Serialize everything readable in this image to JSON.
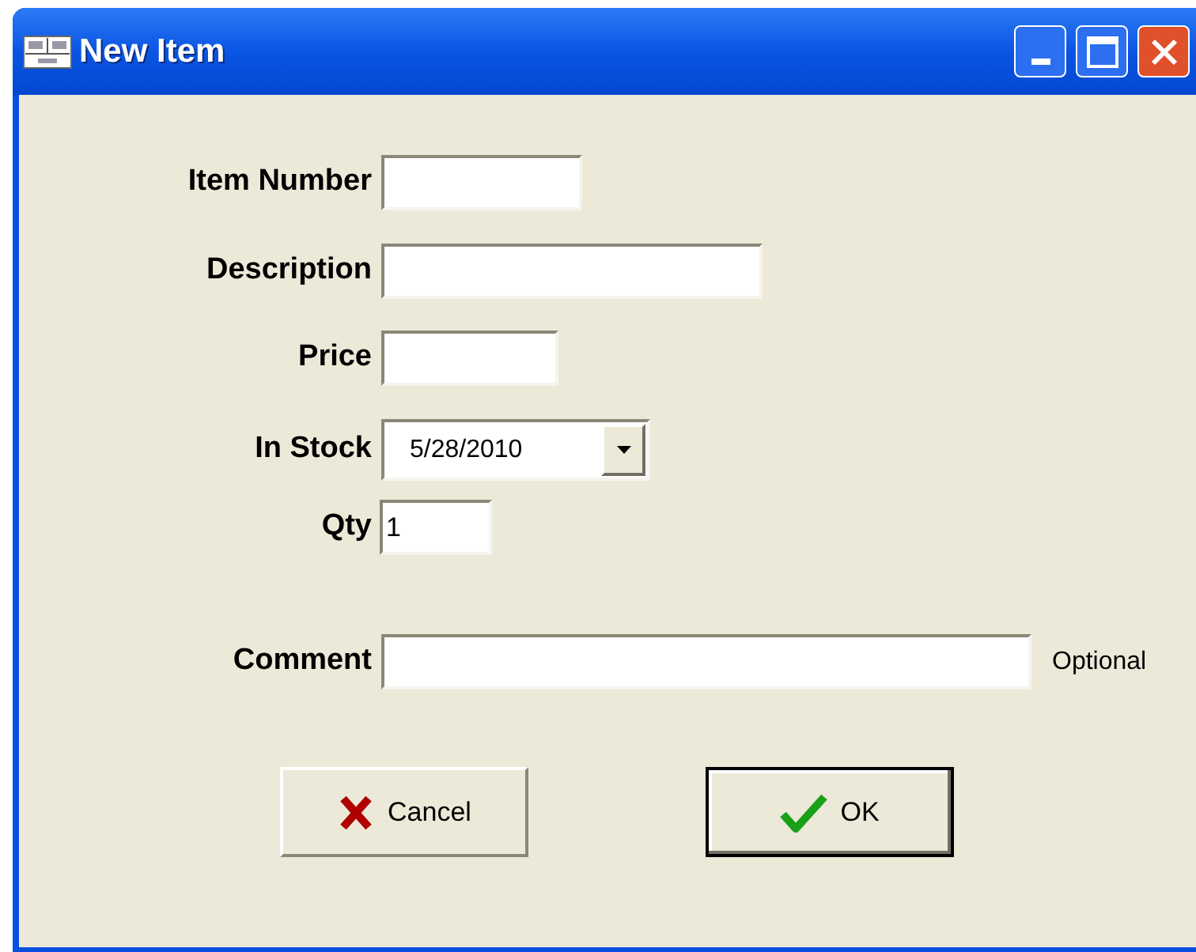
{
  "window": {
    "title": "New Item"
  },
  "fields": [
    {
      "label": "Item Number",
      "kind": "text"
    },
    {
      "label": "Description",
      "kind": "text"
    },
    {
      "label": "Price",
      "kind": "text"
    },
    {
      "label": "In Stock",
      "kind": "date",
      "value": "5/28/2010"
    },
    {
      "label": "Qty",
      "kind": "text",
      "value": "1"
    },
    {
      "label": "Comment",
      "kind": "text",
      "note": "Optional"
    }
  ],
  "buttons": [
    {
      "label": "Cancel",
      "kind": "cancel",
      "default": false
    },
    {
      "label": "OK",
      "kind": "ok",
      "default": true
    }
  ]
}
